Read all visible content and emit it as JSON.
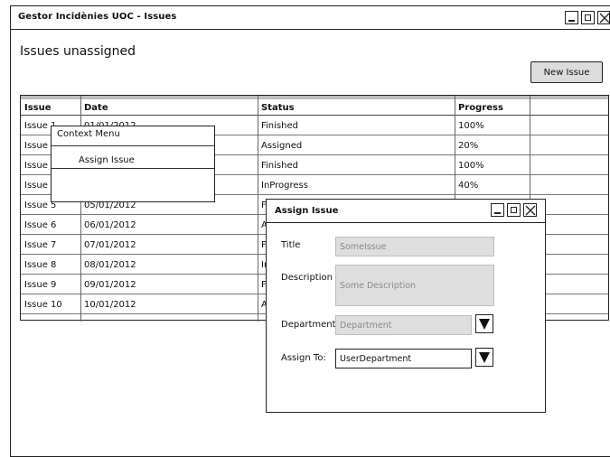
{
  "window": {
    "title": "Gestor Incidènies UOC - Issues"
  },
  "page": {
    "heading": "Issues unassigned",
    "new_issue_label": "New Issue"
  },
  "table": {
    "columns": [
      "Issue",
      "Date",
      "Status",
      "Progress"
    ],
    "rows": [
      {
        "issue": "Issue 1",
        "date": "01/01/2012",
        "status": "Finished",
        "progress": "100%"
      },
      {
        "issue": "Issue 2",
        "date": "",
        "status": "Assigned",
        "progress": "20%"
      },
      {
        "issue": "Issue 3",
        "date": "",
        "status": "Finished",
        "progress": "100%"
      },
      {
        "issue": "Issue 4",
        "date": "",
        "status": "InProgress",
        "progress": "40%"
      },
      {
        "issue": "Issue 5",
        "date": "05/01/2012",
        "status": "Fi",
        "progress": ""
      },
      {
        "issue": "Issue 6",
        "date": "06/01/2012",
        "status": "As",
        "progress": ""
      },
      {
        "issue": "Issue 7",
        "date": "07/01/2012",
        "status": "Fi",
        "progress": ""
      },
      {
        "issue": "Issue 8",
        "date": "08/01/2012",
        "status": "In",
        "progress": ""
      },
      {
        "issue": "Issue 9",
        "date": "09/01/2012",
        "status": "Fi",
        "progress": ""
      },
      {
        "issue": "Issue 10",
        "date": "10/01/2012",
        "status": "As",
        "progress": ""
      }
    ]
  },
  "context_menu": {
    "title": "Context Menu",
    "items": [
      "Assign Issue"
    ]
  },
  "dialog": {
    "title": "Assign Issue",
    "title_label": "Title",
    "title_placeholder": "SomeIssue",
    "description_label": "Description",
    "description_placeholder": "Some Description",
    "department_label": "Department",
    "department_value": "Department",
    "assign_to_label": "Assign To:",
    "assign_to_value": "UserDepartment"
  },
  "icons": {
    "minimize": "minimize-icon",
    "maximize": "maximize-icon",
    "close": "close-icon",
    "dropdown": "chevron-down-icon"
  },
  "colors": {
    "field_bg": "#dedede",
    "button_bg": "#dcdcdc",
    "border": "#222222"
  }
}
